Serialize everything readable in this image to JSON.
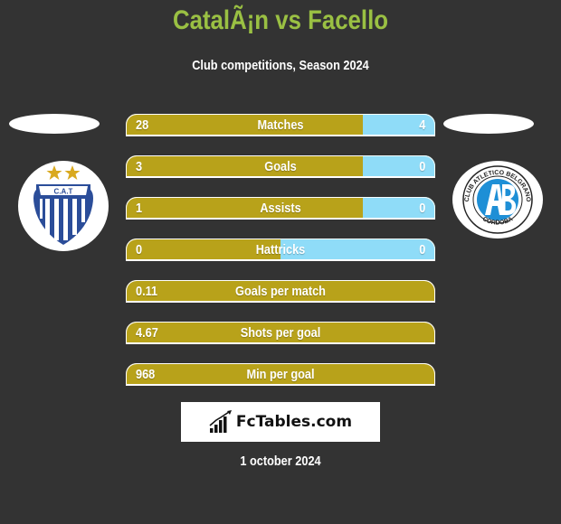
{
  "header": {
    "title": "CatalÃ¡n vs Facello",
    "subtitle": "Club competitions, Season 2024"
  },
  "teams": {
    "left": {
      "name": "C.A.T",
      "logo": "talleres-crest-icon"
    },
    "right": {
      "name": "Club Atletico Belgrano Cordoba",
      "logo": "belgrano-crest-icon",
      "ring_text_top": "CLUB ATLETICO BELGRANO",
      "ring_text_bottom": "CORDOBA"
    }
  },
  "colors": {
    "background": "#333333",
    "title": "#9ac043",
    "left_bar": "#b8a21a",
    "right_bar": "#8fdcf8"
  },
  "stats": [
    {
      "label": "Matches",
      "left": "28",
      "right": "4",
      "right_share": 0.233
    },
    {
      "label": "Goals",
      "left": "3",
      "right": "0",
      "right_share": 0.233
    },
    {
      "label": "Assists",
      "left": "1",
      "right": "0",
      "right_share": 0.233
    },
    {
      "label": "Hattricks",
      "left": "0",
      "right": "0",
      "right_share": 0.5
    },
    {
      "label": "Goals per match",
      "left": "0.11",
      "right": "",
      "right_share": 0
    },
    {
      "label": "Shots per goal",
      "left": "4.67",
      "right": "",
      "right_share": 0
    },
    {
      "label": "Min per goal",
      "left": "968",
      "right": "",
      "right_share": 0
    }
  ],
  "footer": {
    "brand": "FcTables.com",
    "date": "1 october 2024"
  }
}
